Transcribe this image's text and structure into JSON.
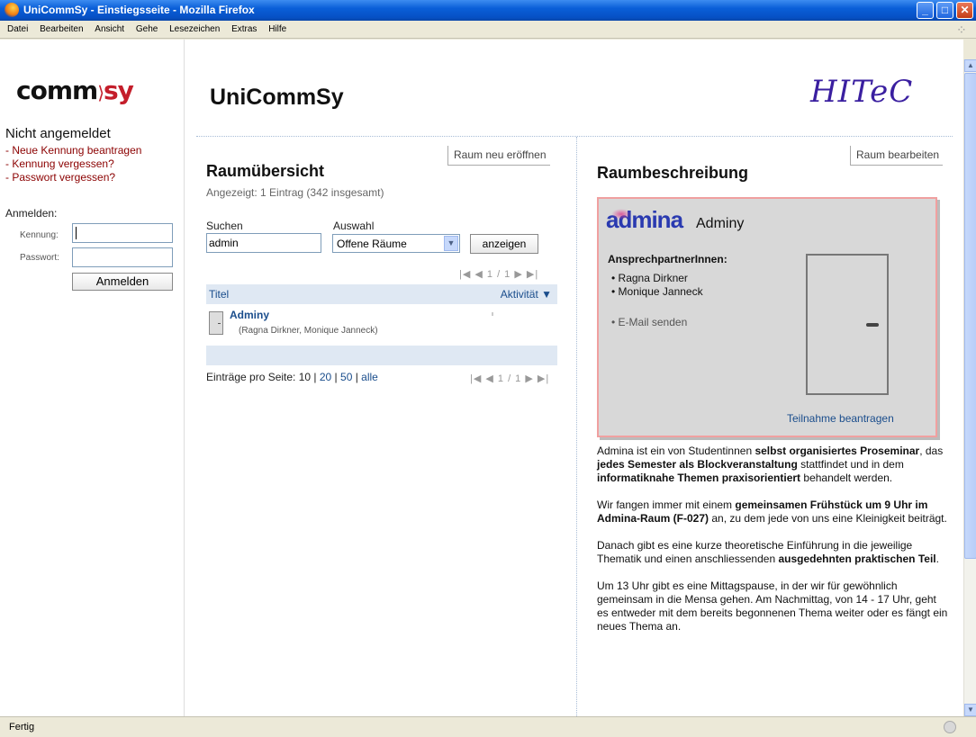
{
  "window": {
    "title": "UniCommSy - Einstiegsseite - Mozilla Firefox",
    "status": "Fertig"
  },
  "menu": [
    "Datei",
    "Bearbeiten",
    "Ansicht",
    "Gehe",
    "Lesezeichen",
    "Extras",
    "Hilfe"
  ],
  "sidebar": {
    "logo_comm": "comm",
    "logo_sy": "sy",
    "status": "Nicht angemeldet",
    "links": [
      "- Neue Kennung beantragen",
      "- Kennung vergessen?",
      "- Passwort vergessen?"
    ],
    "login_label": "Anmelden:",
    "user_label": "Kennung:",
    "password_label": "Passwort:",
    "login_button": "Anmelden"
  },
  "header": {
    "title": "UniCommSy",
    "logo_text": "HITeC"
  },
  "overview": {
    "tab_open": "Raum neu eröffnen",
    "title": "Raumübersicht",
    "subtitle": "Angezeigt: 1 Eintrag (342 insgesamt)",
    "search_label": "Suchen",
    "search_value": "admin",
    "select_label": "Auswahl",
    "select_value": "Offene Räume",
    "show_button": "anzeigen",
    "pager": "|◀ ◀ 1 / 1 ▶ ▶|",
    "col_title": "Titel",
    "col_activity": "Aktivität ▼",
    "room_name": "Adminy",
    "room_persons": "(Ragna Dirkner, Monique Janneck)",
    "per_page_label": "Einträge pro Seite: 10 | ",
    "per_page_20": "20",
    "per_page_50": "50",
    "per_page_all": "alle",
    "per_page_sep": " | "
  },
  "description": {
    "tab_edit": "Raum bearbeiten",
    "title": "Raumbeschreibung",
    "logo_text": "admina",
    "room_name": "Adminy",
    "contacts_title": "AnsprechpartnerInnen:",
    "contacts": [
      "Ragna Dirkner",
      "Monique Janneck"
    ],
    "mail": "E-Mail senden",
    "join": "Teilnahme beantragen",
    "p1_a": "Admina ist ein von Studentinnen ",
    "p1_b": "selbst organisiertes Proseminar",
    "p1_c": ", das ",
    "p1_d": "jedes Semester als Blockveranstaltung",
    "p1_e": " stattfindet und in dem ",
    "p1_f": "informatiknahe Themen praxisorientiert",
    "p1_g": " behandelt werden.",
    "p2_a": "Wir fangen immer mit einem ",
    "p2_b": "gemeinsamen Frühstück um 9 Uhr im Admina-Raum (F-027)",
    "p2_c": " an, zu dem jede von uns eine Kleinigkeit beiträgt.",
    "p3_a": "Danach gibt es eine kurze theoretische Einführung in die jeweilige Thematik und einen anschliessenden ",
    "p3_b": "ausgedehnten praktischen Teil",
    "p3_c": ".",
    "p4": "Um 13 Uhr gibt es eine Mittagspause, in der wir für gewöhnlich gemeinsam in die Mensa gehen. Am Nachmittag, von 14 - 17 Uhr, geht es entweder mit dem bereits begonnenen Thema weiter oder es fängt ein neues Thema an."
  }
}
